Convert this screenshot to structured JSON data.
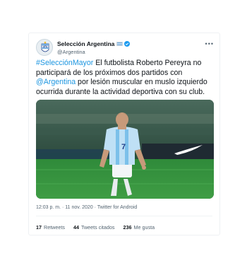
{
  "account": {
    "display_name": "Selección Argentina",
    "handle": "@Argentina",
    "avatar_icon": "afa-crest-icon",
    "flag_icon": "argentina-flag-icon",
    "verified_icon": "verified-badge-icon"
  },
  "more_icon": "more-options-icon",
  "tweet": {
    "hashtag": "#SelecciónMayor",
    "text_part1": " El futbolista Roberto Pereyra no participará de los próximos dos partidos con ",
    "mention": "@Argentina",
    "text_part2": " por lesión muscular en muslo izquierdo ocurrida durante la actividad deportiva con su club."
  },
  "media": {
    "jersey_number": "7"
  },
  "meta": {
    "time": "12:03 p. m.",
    "separator": " · ",
    "date": "11 nov. 2020",
    "source": "Twitter for Android"
  },
  "stats": {
    "retweets_count": "17",
    "retweets_label": "Retweets",
    "quotes_count": "44",
    "quotes_label": "Tweets citados",
    "likes_count": "236",
    "likes_label": "Me gusta"
  },
  "colors": {
    "link": "#1b95e0",
    "verified": "#1d9bf0",
    "secondary_text": "#536471"
  }
}
